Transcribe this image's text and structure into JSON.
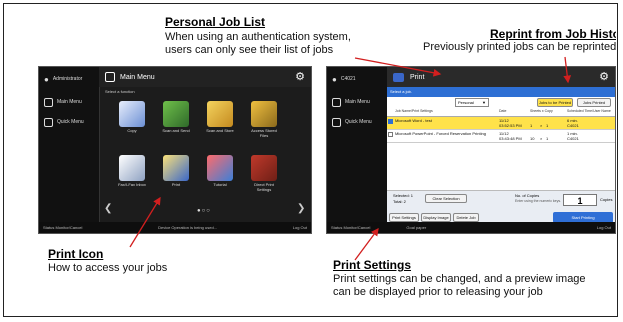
{
  "annotations": {
    "personal_title": "Personal Job List",
    "personal_text": [
      "When using an authentication system,",
      "users can only see their list of jobs"
    ],
    "reprint_title": "Reprint from Job History",
    "reprint_text": "Previously printed jobs can be reprinted",
    "print_icon_title": "Print Icon",
    "print_icon_text": "How to access your jobs",
    "print_settings_title": "Print Settings",
    "print_settings_text": [
      "Print settings can be changed, and a preview image",
      "can be displayed prior to releasing your job"
    ]
  },
  "main_menu": {
    "user": "Administrator",
    "title": "Main Menu",
    "sidebar": [
      "Main Menu",
      "Quick Menu"
    ],
    "prompt": "Select a function",
    "tiles": [
      "Copy",
      "Scan and Send",
      "Scan and Store",
      "Access Stored Files",
      "Fax/I-Fax Inbox",
      "Print",
      "Tutorial",
      "Direct Print Settings"
    ],
    "status": "Status Monitor/Cancel",
    "message": "Device Operation is being used...",
    "logout": "Log Out"
  },
  "print_screen": {
    "user": "C4021",
    "title": "Print",
    "select_job": "Select a job.",
    "filter": "Personal",
    "btn_to_be_printed": "Jobs to be Printed",
    "btn_printed": "Jobs Printed",
    "headers": [
      "Job Name/Print Settings",
      "Date",
      "Sheets x Copy",
      "Scheduled Time/User Name"
    ],
    "rows": [
      {
        "name": "Microsoft Word - test",
        "date": "11/12",
        "time": "03:52:53 PM",
        "copies": "1",
        "sheets": "1",
        "user": "C4021",
        "left": "6 min."
      },
      {
        "name": "Microsoft PowerPoint - Forced Reservation Printing",
        "date": "11/12",
        "time": "03:43:48 PM",
        "copies": "1",
        "sheets": "10",
        "user": "C4021",
        "left": "1 min."
      }
    ],
    "selected": "Selected: 1",
    "total": "Total: 2",
    "clear": "Clear Selection",
    "copies_label": "No. of Copies",
    "copies_hint": "Enter using the numeric keys.",
    "copies_value": "1",
    "copies_unit": "Copies",
    "print_settings": "Print Settings",
    "display_image": "Display Image",
    "delete_job": "Delete Job",
    "start": "Start Printing",
    "status": "Status Monitor/Cancel",
    "message": "Goal paper",
    "logout": "Log Out"
  },
  "colors": {
    "accent_yellow": "#ffe24a",
    "start_blue": "#2f6fd6",
    "arrow_red": "#d21f1f"
  }
}
